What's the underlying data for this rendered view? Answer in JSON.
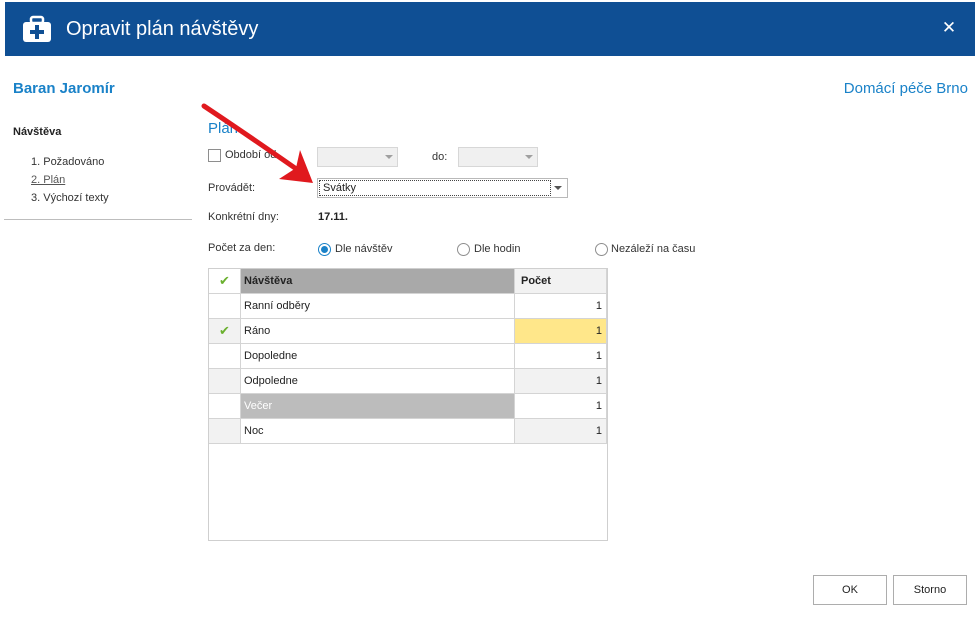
{
  "window": {
    "title": "Opravit plán návštěvy",
    "close_symbol": "✕"
  },
  "header": {
    "patient_name": "Baran Jaromír",
    "organization": "Domácí péče Brno"
  },
  "sidebar": {
    "heading": "Návštěva",
    "steps": [
      {
        "label": "1. Požadováno"
      },
      {
        "label": "2. Plán"
      },
      {
        "label": "3. Výchozí texty"
      }
    ]
  },
  "plan": {
    "section_title": "Plán",
    "period_label": "Období od",
    "period_checked": false,
    "from_value": "",
    "to_label": "do:",
    "to_value": "",
    "provadet_label": "Provádět:",
    "provadet_value": "Svátky",
    "dates_label": "Konkrétní dny:",
    "dates_value": "17.11.",
    "count_label": "Počet za den:",
    "radio_options": [
      "Dle návštěv",
      "Dle hodin",
      "Nezáleží na času"
    ],
    "radio_selected": 0
  },
  "table": {
    "check_icon": "✔",
    "columns": [
      "Návštěva",
      "Počet"
    ],
    "rows": [
      {
        "name": "Ranní odběry",
        "count": "1",
        "checked": false
      },
      {
        "name": "Ráno",
        "count": "1",
        "checked": true
      },
      {
        "name": "Dopoledne",
        "count": "1",
        "checked": false
      },
      {
        "name": "Odpoledne",
        "count": "1",
        "checked": false
      },
      {
        "name": "Večer",
        "count": "1",
        "checked": false
      },
      {
        "name": "Noc",
        "count": "1",
        "checked": false
      }
    ]
  },
  "buttons": {
    "ok": "OK",
    "cancel": "Storno"
  },
  "colors": {
    "titlebar": "#0f4f94",
    "accent": "#1a82c8",
    "check": "#6ab02e",
    "highlight": "#ffe78a",
    "annotation_arrow": "#e0191e"
  }
}
